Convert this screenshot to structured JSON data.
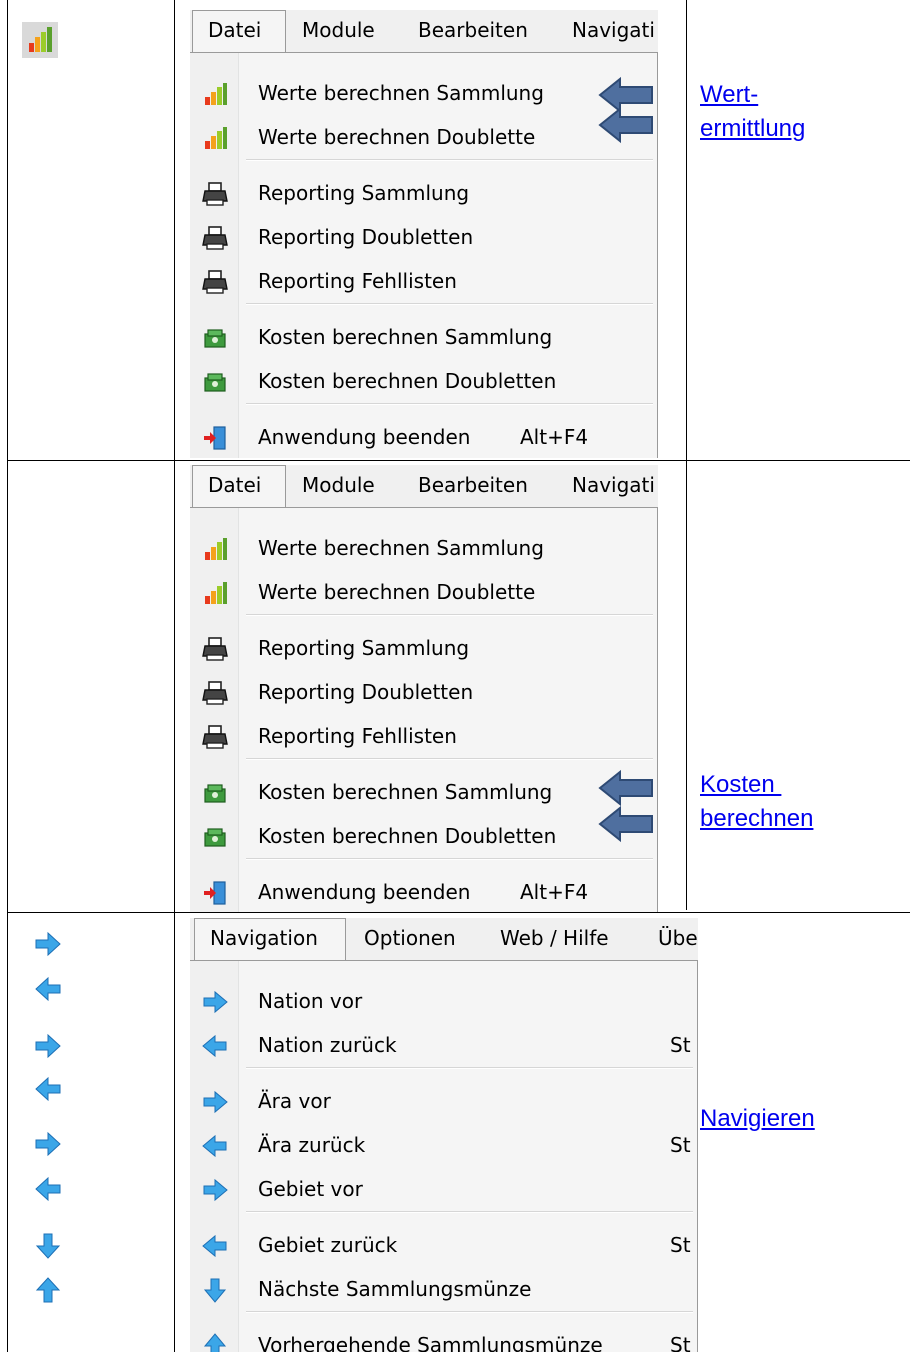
{
  "rows": [
    {
      "menu": {
        "bar": [
          "Datei",
          "Module",
          "Bearbeiten",
          "Navigati"
        ],
        "items": [
          {
            "label": "Werte berechnen Sammlung",
            "icon": "bar-chart-icon"
          },
          {
            "label": "Werte berechnen Doublette",
            "icon": "bar-chart-icon"
          },
          {
            "label": "Reporting Sammlung",
            "icon": "printer-icon"
          },
          {
            "label": "Reporting Doubletten",
            "icon": "printer-icon"
          },
          {
            "label": "Reporting Fehllisten",
            "icon": "printer-icon"
          },
          {
            "label": "Kosten berechnen Sammlung",
            "icon": "money-icon"
          },
          {
            "label": "Kosten berechnen Doubletten",
            "icon": "money-icon"
          },
          {
            "label": "Anwendung beenden",
            "shortcut": "Alt+F4",
            "icon": "exit-icon"
          }
        ]
      },
      "link": [
        "Wert-",
        "ermittlung"
      ]
    },
    {
      "menu": {
        "bar": [
          "Datei",
          "Module",
          "Bearbeiten",
          "Navigati"
        ],
        "items": [
          {
            "label": "Werte berechnen Sammlung",
            "icon": "bar-chart-icon"
          },
          {
            "label": "Werte berechnen Doublette",
            "icon": "bar-chart-icon"
          },
          {
            "label": "Reporting Sammlung",
            "icon": "printer-icon"
          },
          {
            "label": "Reporting Doubletten",
            "icon": "printer-icon"
          },
          {
            "label": "Reporting Fehllisten",
            "icon": "printer-icon"
          },
          {
            "label": "Kosten berechnen Sammlung",
            "icon": "money-icon"
          },
          {
            "label": "Kosten berechnen Doubletten",
            "icon": "money-icon"
          },
          {
            "label": "Anwendung beenden",
            "shortcut": "Alt+F4",
            "icon": "exit-icon"
          }
        ]
      },
      "link": [
        "Kosten ",
        "berechnen"
      ]
    },
    {
      "menu": {
        "bar": [
          "Navigation",
          "Optionen",
          "Web / Hilfe",
          "Übe"
        ],
        "items": [
          {
            "label": "Nation vor",
            "icon": "arrow-right-icon"
          },
          {
            "label": "Nation zurück",
            "shortcut": "St",
            "icon": "arrow-left-icon"
          },
          {
            "label": "Ära vor",
            "icon": "arrow-right-icon"
          },
          {
            "label": "Ära zurück",
            "shortcut": "St",
            "icon": "arrow-left-icon"
          },
          {
            "label": "Gebiet vor",
            "icon": "arrow-right-icon"
          },
          {
            "label": "Gebiet zurück",
            "shortcut": "St",
            "icon": "arrow-left-icon"
          },
          {
            "label": "Nächste Sammlungsmünze",
            "icon": "arrow-down-icon"
          },
          {
            "label": "Vorhergehende Sammlungsmünze",
            "shortcut": "St",
            "icon": "arrow-up-icon"
          }
        ]
      },
      "link": [
        "Navigieren"
      ]
    }
  ],
  "colors": {
    "link": "#0000ee",
    "annotation_arrow": "#4f6f9f",
    "nav_arrow": "#3ba6e8"
  }
}
